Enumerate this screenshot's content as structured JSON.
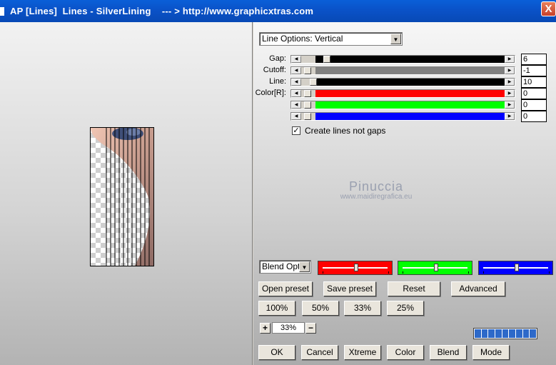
{
  "window": {
    "title": "AP [Lines]  Lines - SilverLining    --- > http://www.graphicxtras.com",
    "close_label": "X"
  },
  "line_options": {
    "selected": "Line Options: Vertical"
  },
  "sliders": [
    {
      "label": "Gap:",
      "value": "6",
      "track_color": "#000000",
      "fill": 0.1
    },
    {
      "label": "Cutoff:",
      "value": "-1",
      "track_color": "#808080",
      "fill": 0.0
    },
    {
      "label": "Line:",
      "value": "10",
      "track_color": "#000000",
      "fill": 0.03
    },
    {
      "label": "Color[R]:",
      "value": "0",
      "track_color": "#ff0000",
      "fill": 0.0
    },
    {
      "label": "",
      "value": "0",
      "track_color": "#00ff00",
      "fill": 0.0
    },
    {
      "label": "",
      "value": "0",
      "track_color": "#0000ff",
      "fill": 0.0
    }
  ],
  "create_lines": {
    "label": "Create lines not gaps",
    "checked": true,
    "mark": "✓"
  },
  "watermark": {
    "name": "Pinuccia",
    "url": "www.maidiregrafica.eu"
  },
  "blend": {
    "selected": "Blend Optio",
    "strips": [
      {
        "color": "#ff0000",
        "level": 0.5
      },
      {
        "color": "#00ff00",
        "level": 0.5
      },
      {
        "color": "#0000ff",
        "level": 0.5
      }
    ]
  },
  "buttons": {
    "open_preset": "Open preset",
    "save_preset": "Save preset",
    "reset": "Reset",
    "advanced": "Advanced",
    "zoom_100": "100%",
    "zoom_50": "50%",
    "zoom_33": "33%",
    "zoom_25": "25%",
    "plus": "+",
    "minus": "−",
    "ok": "OK",
    "cancel": "Cancel",
    "xtreme": "Xtreme",
    "color": "Color",
    "blend": "Blend",
    "mode": "Mode"
  },
  "zoom": {
    "value": "33%"
  },
  "progress": {
    "segments": 9,
    "filled": 9
  },
  "colors": {
    "titlebar": "#0a52c8",
    "progress": "#2d69c9"
  }
}
